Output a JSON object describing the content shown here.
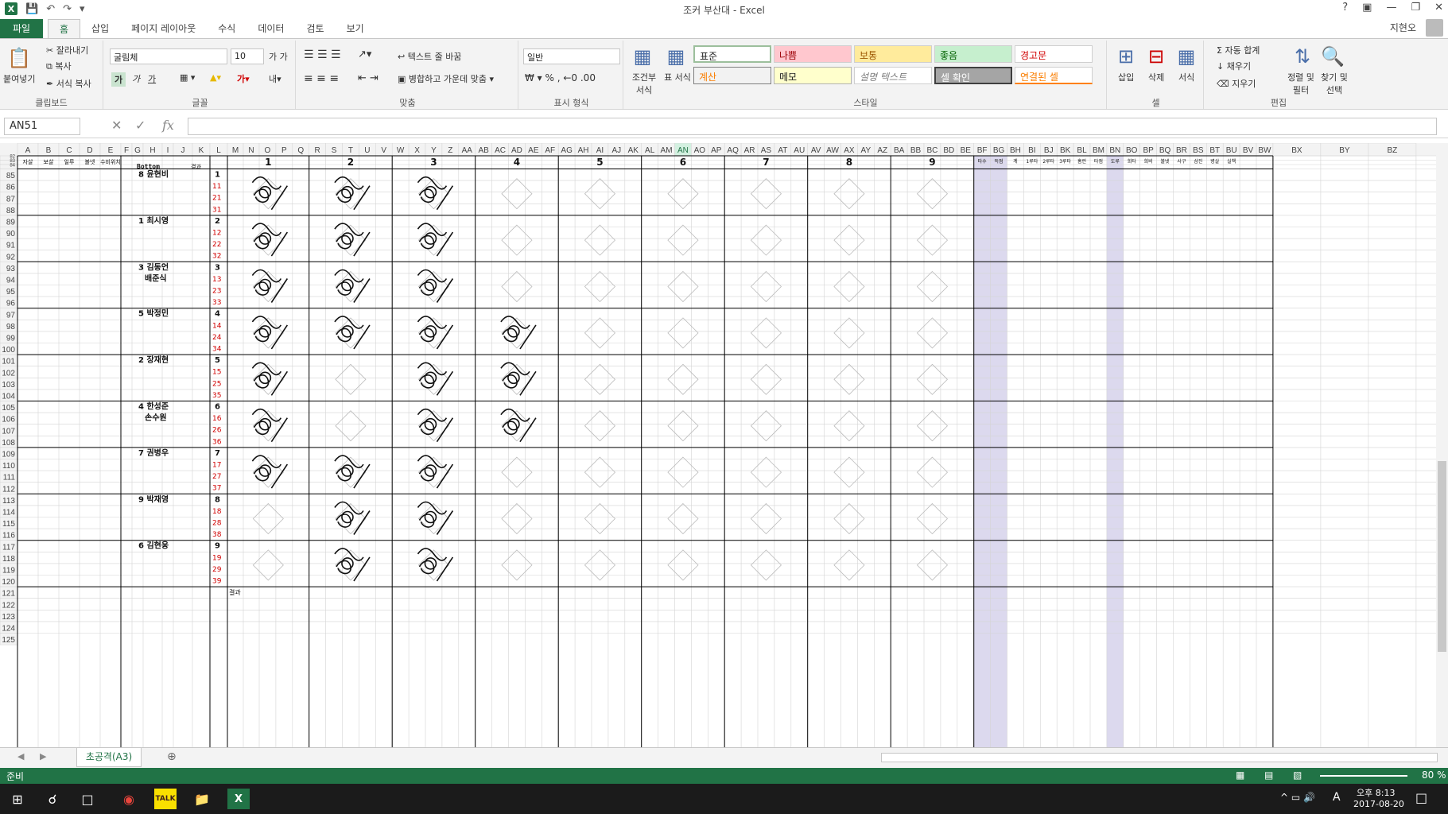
{
  "window": {
    "title": "조커 부산대 - Excel",
    "user": "지현오"
  },
  "ribbon_tabs": [
    "파일",
    "홈",
    "삽입",
    "페이지 레이아웃",
    "수식",
    "데이터",
    "검토",
    "보기"
  ],
  "clipboard": {
    "paste": "붙여넣기",
    "cut": "잘라내기",
    "copy": "복사",
    "format_painter": "서식 복사",
    "label": "클립보드"
  },
  "font": {
    "name": "굴림체",
    "size": "10",
    "bold": "가",
    "italic": "가",
    "underline": "가",
    "label": "글꼴"
  },
  "alignment": {
    "wrap": "텍스트 줄 바꿈",
    "merge": "병합하고 가운데 맞춤",
    "label": "맞춤"
  },
  "number": {
    "format": "일반",
    "label": "표시 형식"
  },
  "styles": {
    "conditional": "조건부 서식",
    "table": "표 서식",
    "label": "스타일",
    "cells": [
      "표준",
      "나쁨",
      "보통",
      "좋음",
      "경고문",
      "계산",
      "메모",
      "설명 텍스트",
      "셀 확인",
      "연결된 셀"
    ]
  },
  "cells_group": {
    "insert": "삽입",
    "delete": "삭제",
    "format": "서식",
    "label": "셀"
  },
  "editing": {
    "autosum": "자동 합계",
    "fill": "채우기",
    "clear": "지우기",
    "sort": "정렬 및 필터",
    "find": "찾기 및 선택",
    "label": "편집"
  },
  "formula_bar": {
    "name_box": "AN51",
    "fx": "fx"
  },
  "columns": [
    "A",
    "B",
    "C",
    "D",
    "E",
    "F",
    "G",
    "H",
    "I",
    "J",
    "K",
    "L",
    "M",
    "N",
    "O",
    "P",
    "Q",
    "R",
    "S",
    "T",
    "U",
    "V",
    "W",
    "X",
    "Y",
    "Z",
    "AA",
    "AB",
    "AC",
    "AD",
    "AE",
    "AF",
    "AG",
    "AH",
    "AI",
    "AJ",
    "AK",
    "AL",
    "AM",
    "AN",
    "AO",
    "AP",
    "AQ",
    "AR",
    "AS",
    "AT",
    "AU",
    "AV",
    "AW",
    "AX",
    "AY",
    "AZ",
    "BA",
    "BB",
    "BC",
    "BD",
    "BE",
    "BF",
    "BG",
    "BH",
    "BI",
    "BJ",
    "BK",
    "BL",
    "BM",
    "BN",
    "BO",
    "BP",
    "BQ",
    "BR",
    "BS",
    "BT",
    "BU",
    "BV",
    "BW",
    "BX",
    "BY",
    "BZ"
  ],
  "rows_header": [
    "82",
    "83",
    "84"
  ],
  "rows": [
    "85",
    "86",
    "87",
    "88",
    "89",
    "90",
    "91",
    "92",
    "93",
    "94",
    "95",
    "96",
    "97",
    "98",
    "99",
    "100",
    "101",
    "102",
    "103",
    "104",
    "105",
    "106",
    "107",
    "108",
    "109",
    "110",
    "111",
    "112",
    "113",
    "114",
    "115",
    "116",
    "117",
    "118",
    "119",
    "120",
    "121",
    "122",
    "123",
    "124",
    "125"
  ],
  "header_left": {
    "a": "자살",
    "b": "보살",
    "c": "일루",
    "d": "볼넷",
    "e": "수비위치",
    "bottom": "Bottom",
    "k": "결과"
  },
  "innings": [
    "1",
    "2",
    "3",
    "4",
    "5",
    "6",
    "7",
    "8",
    "9"
  ],
  "stat_headers": [
    "타수",
    "득점",
    "계",
    "1루타",
    "2루타",
    "3루타",
    "홈런",
    "타점",
    "도루",
    "희타",
    "희비",
    "볼넷",
    "사구",
    "삼진",
    "병살",
    "실책"
  ],
  "batters": [
    {
      "no": "1",
      "name": "8 윤현비",
      "sub": "",
      "nums": [
        "11",
        "21",
        "31"
      ]
    },
    {
      "no": "2",
      "name": "1 최시영",
      "sub": "",
      "nums": [
        "12",
        "22",
        "32"
      ]
    },
    {
      "no": "3",
      "name": "3 김동언",
      "sub": "배준식",
      "nums": [
        "13",
        "23",
        "33"
      ]
    },
    {
      "no": "4",
      "name": "5 박정민",
      "sub": "",
      "nums": [
        "14",
        "24",
        "34"
      ]
    },
    {
      "no": "5",
      "name": "2 장재현",
      "sub": "",
      "nums": [
        "15",
        "25",
        "35"
      ]
    },
    {
      "no": "6",
      "name": "4 한성준",
      "sub": "손수원",
      "nums": [
        "16",
        "26",
        "36"
      ]
    },
    {
      "no": "7",
      "name": "7 권병우",
      "sub": "",
      "nums": [
        "17",
        "27",
        "37"
      ]
    },
    {
      "no": "8",
      "name": "9 박재영",
      "sub": "",
      "nums": [
        "18",
        "28",
        "38"
      ]
    },
    {
      "no": "9",
      "name": "6 김현웅",
      "sub": "",
      "nums": [
        "19",
        "29",
        "39"
      ]
    }
  ],
  "total_label": "결과",
  "sheet_tab": "초공격(A3)",
  "status": {
    "ready": "준비",
    "zoom": "80 %"
  },
  "taskbar": {
    "time": "오후 8:13",
    "date": "2017-08-20",
    "ime": "A"
  },
  "colors": {
    "accent": "#217346",
    "grid": "#d4d4d4",
    "highlight_col": "#dcd9ee",
    "red_num": "#d00000"
  }
}
